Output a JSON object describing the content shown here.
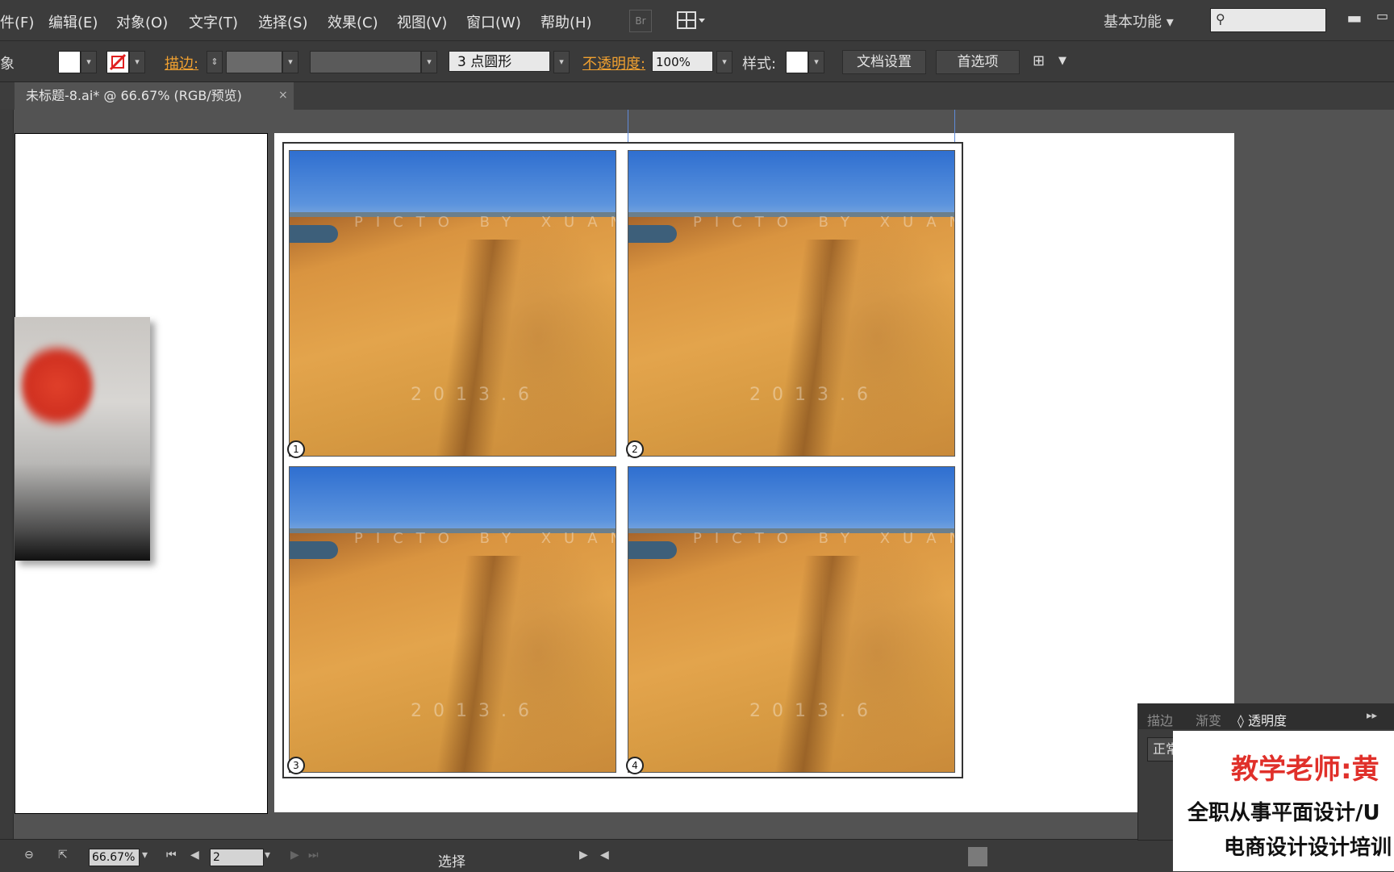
{
  "menu": {
    "items": [
      "件(F)",
      "编辑(E)",
      "对象(O)",
      "文字(T)",
      "选择(S)",
      "效果(C)",
      "视图(V)",
      "窗口(W)",
      "帮助(H)"
    ],
    "bridge_label": "Br",
    "workspace_label": "基本功能 ▾",
    "search_icon_glyph": "⚲",
    "minimize_glyph": "▬",
    "maximize_glyph": "▭"
  },
  "controlbar": {
    "selection_label": "象",
    "fill_color": "#ffffff",
    "stroke_label": "描边:",
    "stroke_spin": "⇕",
    "brush_value": "3 点圆形",
    "opacity_label": "不透明度:",
    "opacity_value": "100%",
    "style_label": "样式:",
    "doc_setup_button": "文档设置",
    "prefs_button": "首选项",
    "arrange_glyph": "⊞"
  },
  "document": {
    "tab_title": "未标题-8.ai* @ 66.67% (RGB/预览)",
    "close_glyph": "×"
  },
  "photos": [
    {
      "number": "1",
      "watermark_top": "PICTO BY XUAN",
      "watermark_date": "2013.6"
    },
    {
      "number": "2",
      "watermark_top": "PICTO BY XUAN",
      "watermark_date": "2013.6"
    },
    {
      "number": "3",
      "watermark_top": "PICTO BY XUAN",
      "watermark_date": "2013.6"
    },
    {
      "number": "4",
      "watermark_top": "PICTO BY XUAN",
      "watermark_date": "2013.6"
    }
  ],
  "statusbar": {
    "zoom_value": "66.67%",
    "page_value": "2",
    "tool_label": "选择",
    "first_glyph": "⏮",
    "prev_glyph": "◀",
    "next_glyph": "▶",
    "last_glyph": "⏭"
  },
  "panel": {
    "tabs": [
      "描边",
      "渐变",
      "◊ 透明度"
    ],
    "collapse_glyph": "▸▸",
    "blend_mode": "正常"
  },
  "promo": {
    "title": "教学老师:黄",
    "line1": "全职从事平面设计/U",
    "line2": "电商设计设计培训"
  },
  "colors": {
    "accent_orange": "#f0a030",
    "guide_blue": "#5f8ad8",
    "promo_red": "#e0302a"
  }
}
